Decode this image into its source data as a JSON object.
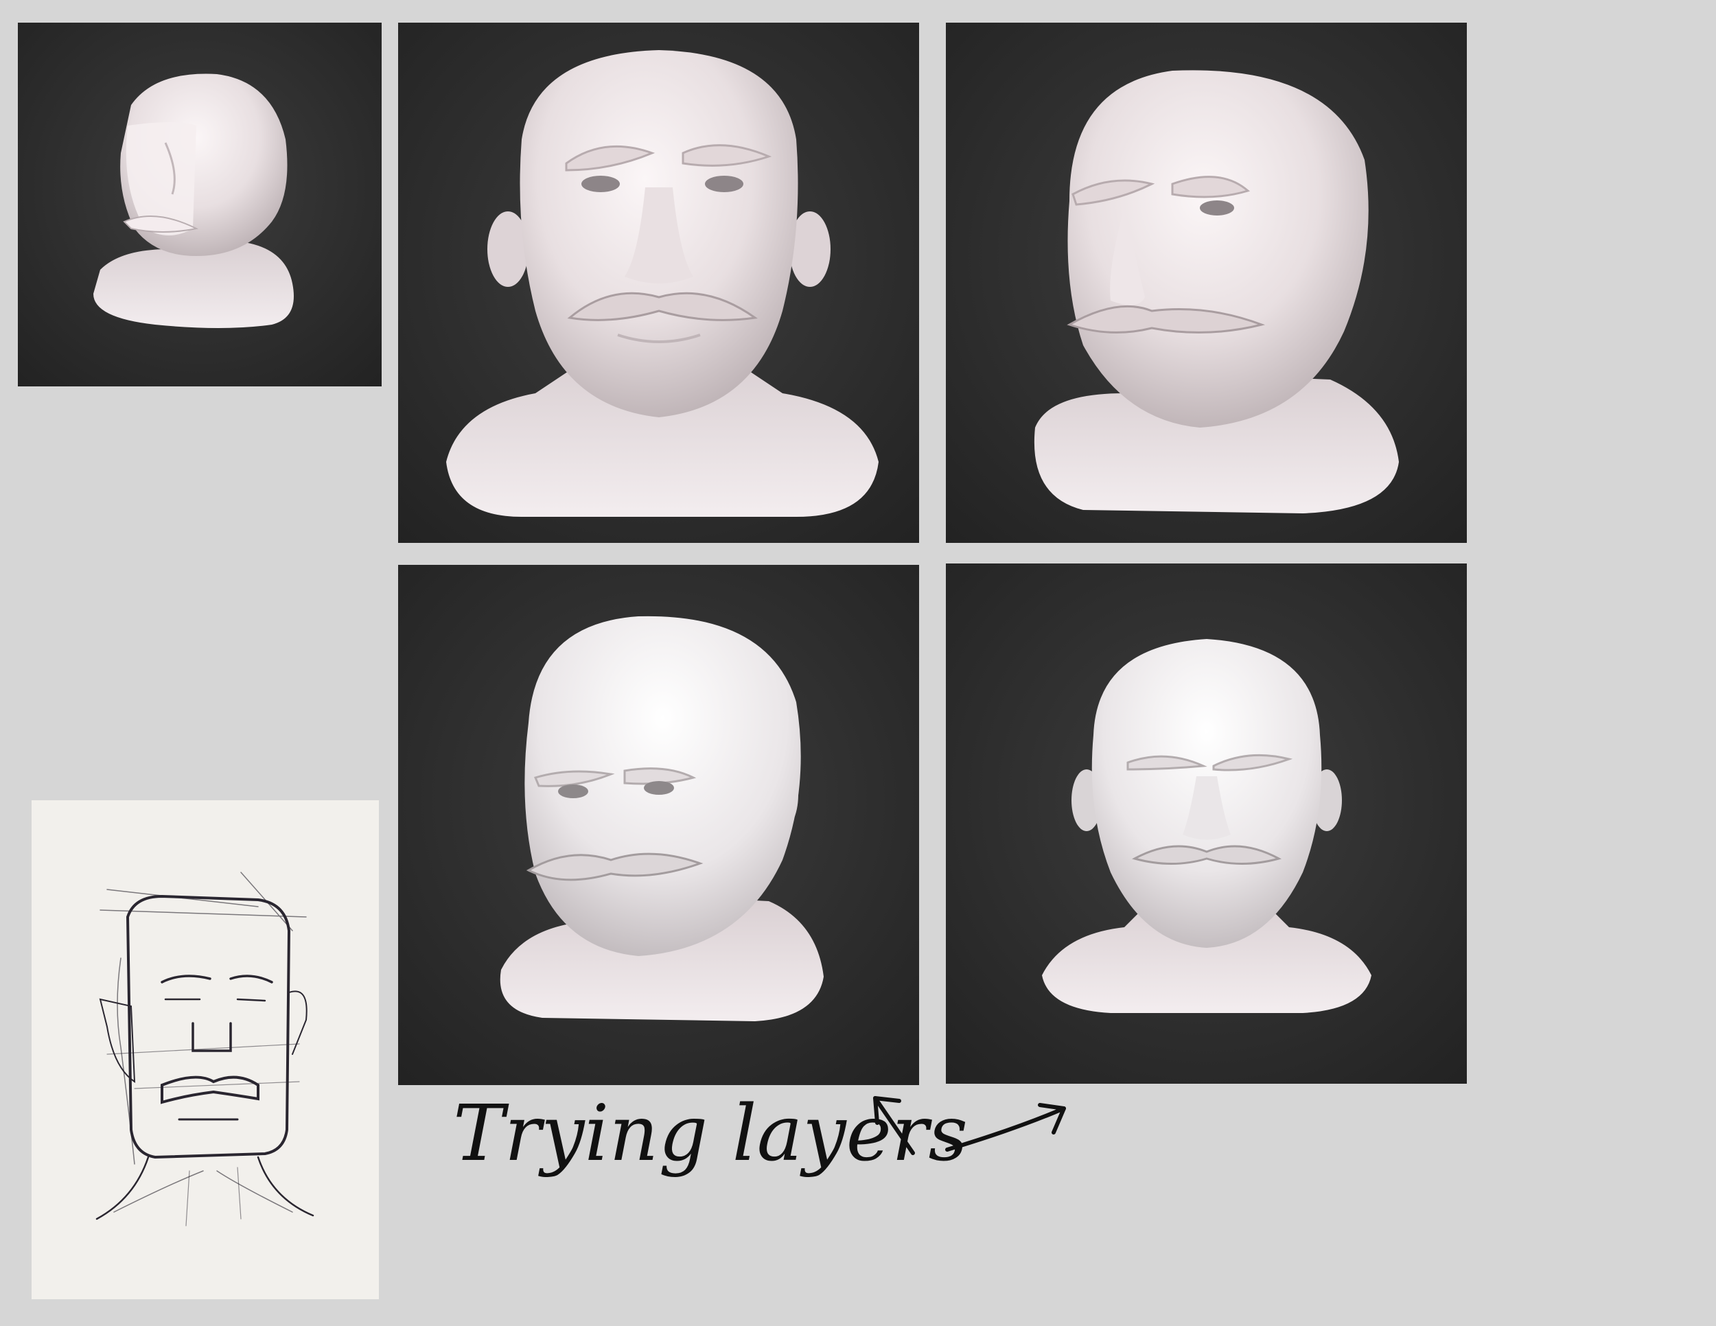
{
  "board": {
    "background": "#d6d6d6",
    "viewport_background": "#2b2b2b",
    "clay_color": "#e9e1e3"
  },
  "panels": [
    {
      "name": "render-sketch-blockout",
      "subject": "head-bust-icon"
    },
    {
      "name": "render-front-mustache",
      "subject": "head-bust-icon"
    },
    {
      "name": "render-three-quarter-left",
      "subject": "head-bust-icon"
    },
    {
      "name": "render-layers-three-quarter",
      "subject": "head-bust-icon"
    },
    {
      "name": "render-layers-front",
      "subject": "head-bust-icon"
    }
  ],
  "reference_sketch": {
    "subject": "pen-sketch-head-icon"
  },
  "annotation": {
    "text": "Trying layers",
    "arrows": [
      "arrow-up-left-icon",
      "arrow-right-icon"
    ]
  }
}
